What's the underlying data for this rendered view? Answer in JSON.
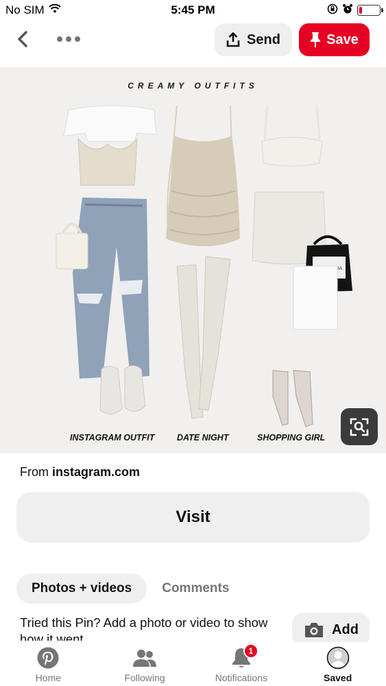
{
  "status_bar": {
    "carrier": "No SIM",
    "time": "5:45 PM",
    "battery_level": 0.15
  },
  "top_bar": {
    "send_label": "Send",
    "save_label": "Save",
    "save_color": "#e60023"
  },
  "pin": {
    "image_title": "CREAMY OUTFITS",
    "outfit_labels": [
      "INSTAGRAM OUTFIT",
      "DATE NIGHT",
      "SHOPPING GIRL"
    ],
    "bag_brand": "BALENCIAGA"
  },
  "details": {
    "source_prefix": "From",
    "source_domain": "instagram.com",
    "visit_label": "Visit"
  },
  "tabs": [
    {
      "label": "Photos + videos",
      "active": true
    },
    {
      "label": "Comments",
      "active": false
    }
  ],
  "tried": {
    "text": "Tried this Pin? Add a photo or video to show how it went",
    "add_label": "Add"
  },
  "bottom_nav": {
    "items": [
      {
        "label": "Home",
        "icon": "pinterest-logo-icon",
        "active": false
      },
      {
        "label": "Following",
        "icon": "people-icon",
        "active": false
      },
      {
        "label": "Notifications",
        "icon": "bell-icon",
        "active": false
      },
      {
        "label": "Saved",
        "icon": "user-avatar-icon",
        "active": true
      }
    ],
    "notification_count": "1"
  }
}
